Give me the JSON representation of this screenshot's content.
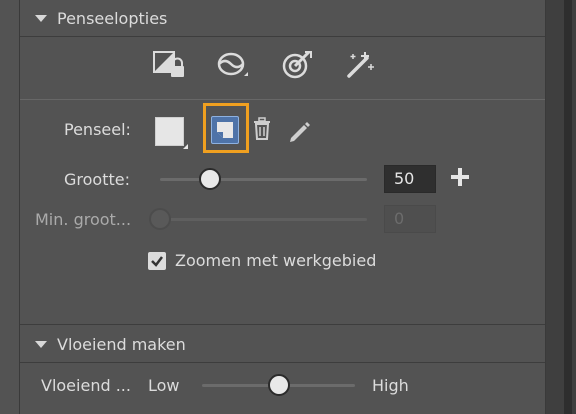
{
  "brush_options": {
    "header": "Penseelopties",
    "tools": [
      {
        "icon": "lock-layer-icon"
      },
      {
        "icon": "brush-mode-icon"
      },
      {
        "icon": "target-pen-icon"
      },
      {
        "icon": "magic-wand-icon"
      }
    ],
    "brush_label": "Penseel:",
    "size_label": "Grootte:",
    "size_value": "50",
    "size_level": 0.24,
    "min_size_label": "Min. groot...",
    "min_size_value": "0",
    "min_size_level": 0.0,
    "zoom_checkbox_label": "Zoomen met werkgebied",
    "zoom_checked": true
  },
  "smoothing": {
    "header": "Vloeiend maken",
    "label": "Vloeiend ...",
    "low_label": "Low",
    "high_label": "High",
    "level": 0.5
  },
  "colors": {
    "panel": "#535353",
    "highlight": "#f0a020",
    "selected_fill": "#4e73a8"
  }
}
